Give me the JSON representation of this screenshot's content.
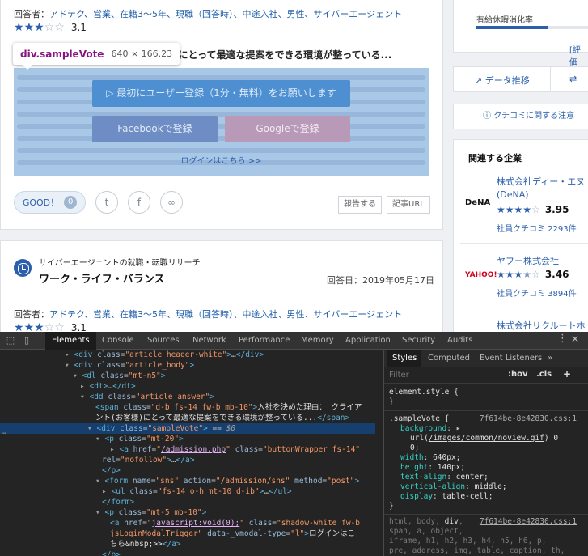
{
  "answer1": {
    "label": "回答者：",
    "tags": "アドテク、営業、在籍3〜5年、現職（回答時）、中途入社、男性、サイバーエージェント",
    "stars_full": 3,
    "stars_total": 5,
    "score": "3.1",
    "question_tail": "客様)にとって最適な提案をできる環境が整っている...",
    "register_button": "最初にユーザー登録（1分・無料）をお願いします",
    "facebook_button": "Facebookで登録",
    "google_button": "Googleで登録",
    "login_link": "ログインはこちら >>",
    "good_label": "GOOD！",
    "good_count": "0",
    "report_label": "報告する",
    "article_url_label": "記事URL"
  },
  "tooltip": {
    "tag": "div.sampleVote",
    "dims": "640 × 166.23"
  },
  "answer2": {
    "subtitle": "サイバーエージェントの就職・転職リサーチ",
    "title": "ワーク・ライフ・バランス",
    "date": "回答日：2019年05月17日",
    "label": "回答者：",
    "tags": "アドテク、営業、在籍3〜5年、現職（回答時）、中途入社、男性、サイバーエージェント",
    "score": "3.1"
  },
  "sidebar": {
    "paid_leave": "有給休暇消化率",
    "paid_leave_level": 0.62,
    "eval_link": "[評価",
    "tab_trend": "データ推移",
    "kuchikomi": "クチコミに関する注意",
    "related_title": "関連する企業",
    "companies": [
      {
        "logo": "DeNA",
        "name1": "株式会社ディー・エヌ",
        "name2": "(DeNA)",
        "stars_full": 4,
        "score": "3.95",
        "count": "社員クチコミ 2293件"
      },
      {
        "logo": "YAHOO!",
        "name1": "ヤフー株式会社",
        "name2": "",
        "stars_full": 3,
        "score": "3.46",
        "count": "社員クチコミ 3894件"
      },
      {
        "logo": "",
        "name1": "株式会社リクルートホ",
        "name2": "",
        "stars_full": 0,
        "score": "",
        "count": ""
      }
    ]
  },
  "devtools": {
    "tabs": [
      "Elements",
      "Console",
      "Sources",
      "Network",
      "Performance",
      "Memory",
      "Application",
      "Security",
      "Audits"
    ],
    "style_tabs": [
      "Styles",
      "Computed",
      "Event Listeners"
    ],
    "filter_placeholder": "Filter",
    "hov": ":hov",
    "cls": ".cls",
    "element_style": "element.style {",
    "source1": "7f614be-8e42830.css:1",
    "source2": "7f614be-8e42830.css:1"
  }
}
